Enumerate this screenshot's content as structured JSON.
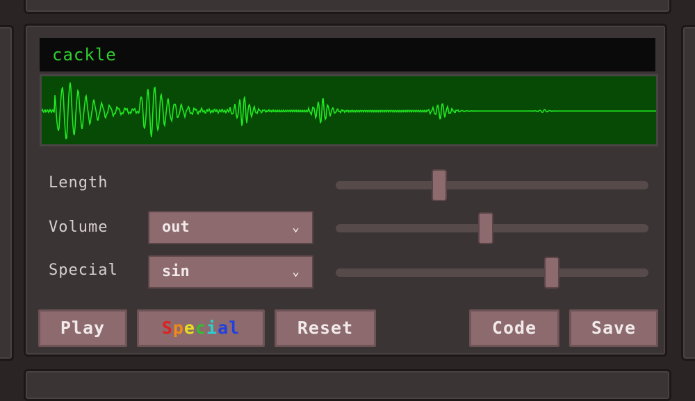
{
  "sound": {
    "name": "cackle"
  },
  "controls": [
    {
      "label": "Length",
      "slider": 0.33
    },
    {
      "label": "Volume",
      "select": "out",
      "slider": 0.48
    },
    {
      "label": "Special",
      "select": "sin",
      "slider": 0.69
    }
  ],
  "buttons": {
    "play": "Play",
    "special_letters": [
      "S",
      "p",
      "e",
      "c",
      "i",
      "a",
      "l"
    ],
    "special_colors": [
      "#e02020",
      "#f08a1a",
      "#e6e020",
      "#30c030",
      "#2ad0d0",
      "#2040e0",
      "#2040e0"
    ],
    "reset": "Reset",
    "code": "Code",
    "save": "Save"
  },
  "icons": {
    "dropdown": "chevron-down-icon"
  },
  "colors": {
    "wave_bg": "#064a06",
    "wave_line": "#22e822",
    "name_text": "#2fd02f",
    "button": "#8c6a6e"
  }
}
